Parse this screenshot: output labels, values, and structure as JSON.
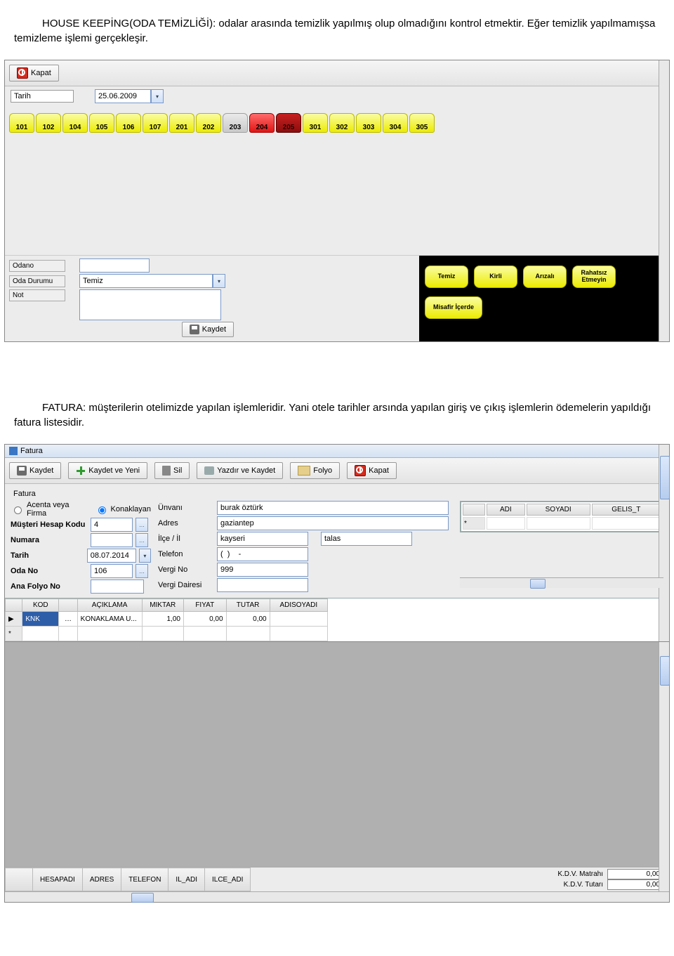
{
  "doc": {
    "p1": "HOUSE KEEPİNG(ODA TEMİZLİĞİ): odalar arasında temizlik yapılmış olup olmadığını kontrol etmektir. Eğer temizlik yapılmamışsa temizleme işlemi gerçekleşir.",
    "p2": "FATURA: müşterilerin otelimizde yapılan işlemleridir. Yani otele tarihler arsında yapılan giriş ve çıkış işlemlerin ödemelerin yapıldığı fatura listesidir."
  },
  "app1": {
    "close_btn": "Kapat",
    "date_label": "Tarih",
    "date_value": "25.06.2009",
    "rooms": [
      {
        "no": "101",
        "c": "yellow"
      },
      {
        "no": "102",
        "c": "yellow"
      },
      {
        "no": "104",
        "c": "yellow"
      },
      {
        "no": "105",
        "c": "yellow"
      },
      {
        "no": "106",
        "c": "yellow"
      },
      {
        "no": "107",
        "c": "yellow"
      },
      {
        "no": "201",
        "c": "yellow"
      },
      {
        "no": "202",
        "c": "yellow"
      },
      {
        "no": "203",
        "c": "grey"
      },
      {
        "no": "204",
        "c": "red"
      },
      {
        "no": "205",
        "c": "darkred"
      },
      {
        "no": "301",
        "c": "yellow"
      },
      {
        "no": "302",
        "c": "yellow"
      },
      {
        "no": "303",
        "c": "yellow"
      },
      {
        "no": "304",
        "c": "yellow"
      },
      {
        "no": "305",
        "c": "yellow"
      }
    ],
    "labels": {
      "odano": "Odano",
      "oda_durumu": "Oda Durumu",
      "not": "Not"
    },
    "oda_durumu_value": "Temiz",
    "save_btn": "Kaydet",
    "statuses": [
      "Temiz",
      "Kirli",
      "Arızalı",
      "Rahatsız Etmeyin",
      "Misafir İçerde"
    ]
  },
  "app2": {
    "title": "Fatura",
    "toolbar": {
      "kaydet": "Kaydet",
      "kaydet_yeni": "Kaydet ve Yeni",
      "sil": "Sil",
      "yazdir": "Yazdır  ve Kaydet",
      "folyo": "Folyo",
      "kapat": "Kapat"
    },
    "group": "Fatura",
    "radio1": "Acenta veya Firma",
    "radio2": "Konaklayan",
    "left": {
      "musteri_kodu_lbl": "Müşteri Hesap Kodu",
      "musteri_kodu": "4",
      "numara_lbl": "Numara",
      "numara": "",
      "tarih_lbl": "Tarih",
      "tarih": "08.07.2014",
      "odano_lbl": "Oda No",
      "odano": "106",
      "anafolyo_lbl": "Ana Folyo No",
      "anafolyo": ""
    },
    "mid": {
      "unvani_lbl": "Ünvanı",
      "unvani": "burak öztürk",
      "adres_lbl": "Adres",
      "adres": "gaziantep",
      "ilce_lbl": "İlçe / İl",
      "ilce": "kayseri",
      "il": "talas",
      "telefon_lbl": "Telefon",
      "telefon": "(  )    -",
      "vergino_lbl": "Vergi No",
      "vergino": "999",
      "vergidaire_lbl": "Vergi Dairesi",
      "vergidaire": ""
    },
    "mini_cols": [
      "ADI",
      "SOYADI",
      "GELIS_T"
    ],
    "grid_cols": [
      "KOD",
      "AÇIKLAMA",
      "MIKTAR",
      "FIYAT",
      "TUTAR",
      "ADISOYADI"
    ],
    "grid_row": {
      "kod": "KNK",
      "aciklama": "KONAKLAMA U...",
      "miktar": "1,00",
      "fiyat": "0,00",
      "tutar": "0,00",
      "adisoyadi": ""
    },
    "footer_cols": [
      "HESAPADI",
      "ADRES",
      "TELEFON",
      "IL_ADI",
      "ILCE_ADI"
    ],
    "kdv": {
      "matrah_lbl": "K.D.V. Matrahı",
      "matrah": "0,00",
      "tutar_lbl": "K.D.V. Tutarı",
      "tutar": "0,00"
    }
  }
}
